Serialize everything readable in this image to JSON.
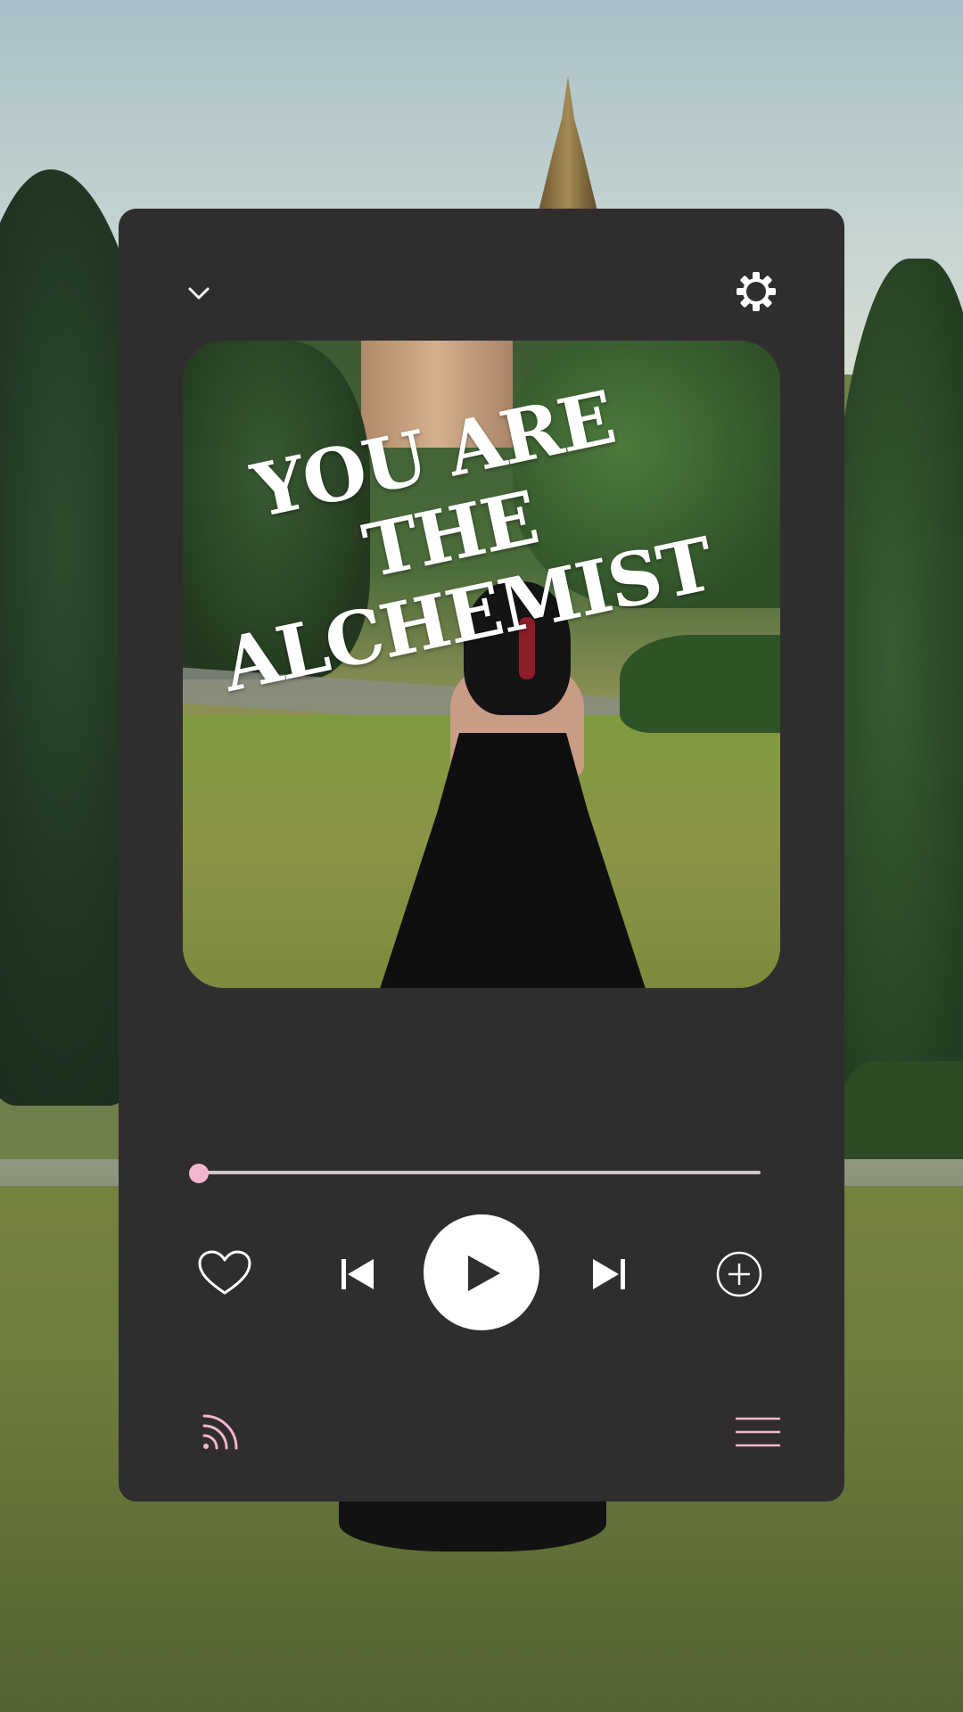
{
  "artwork": {
    "title_text": "YOU ARE THE\nALCHEMIST"
  },
  "playback": {
    "progress_fraction": 0.0
  },
  "icons": {
    "collapse": "chevron-down-icon",
    "settings": "gear-icon",
    "like": "heart-icon",
    "previous": "skip-previous-icon",
    "play": "play-icon",
    "next": "skip-next-icon",
    "add": "add-circle-icon",
    "cast": "cast-icon",
    "queue": "queue-list-icon"
  },
  "colors": {
    "card": "#302d2f",
    "accent_pink": "#f4b6cf",
    "icon_white": "#ffffff"
  }
}
